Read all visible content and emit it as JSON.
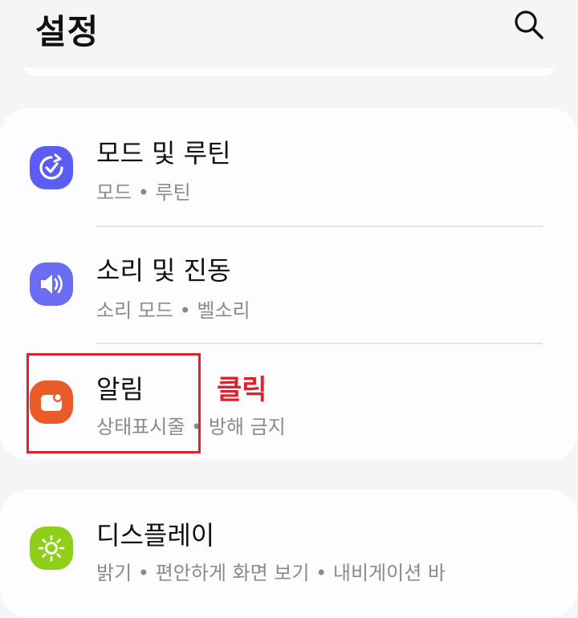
{
  "header": {
    "title": "설정",
    "search_icon": "search-icon"
  },
  "items": [
    {
      "label": "모드 및 루틴",
      "sub": "모드 • 루틴",
      "icon": "routine-check-icon",
      "color": "#5b5ef0"
    },
    {
      "label": "소리 및 진동",
      "sub": "소리 모드 • 벨소리",
      "icon": "speaker-icon",
      "color": "#6a6df2"
    },
    {
      "label": "알림",
      "sub": "상태표시줄 • 방해 금지",
      "icon": "notification-icon",
      "color": "#ea5b2a"
    },
    {
      "label": "디스플레이",
      "sub": "밝기 • 편안하게 화면 보기 • 내비게이션 바",
      "icon": "brightness-icon",
      "color": "#8fcf1a"
    }
  ],
  "annotation": {
    "text": "클릭",
    "color": "#e0202a"
  }
}
